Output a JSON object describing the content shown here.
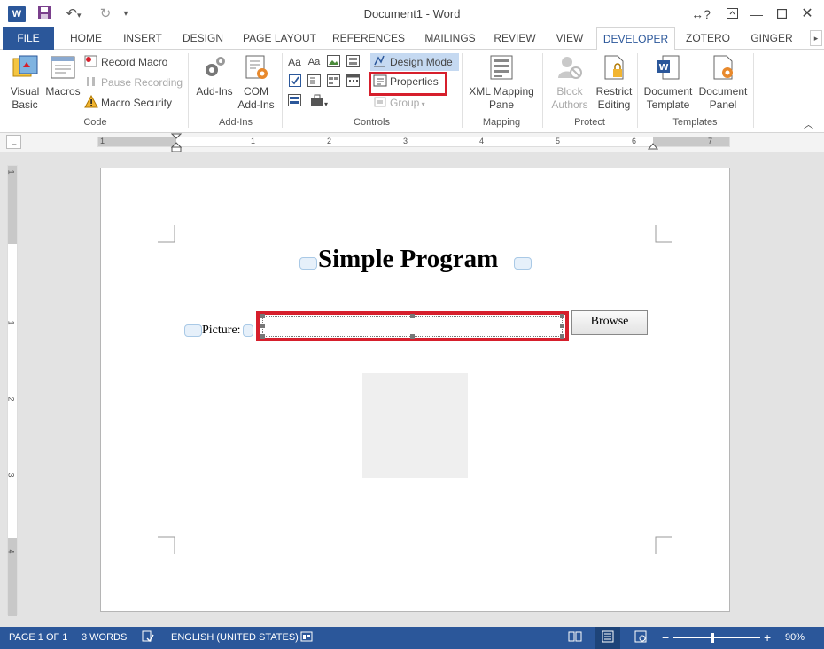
{
  "app": {
    "title": "Document1 - Word",
    "logo_letter": "W",
    "help_label": "?"
  },
  "tabs": [
    {
      "label": "FILE"
    },
    {
      "label": "HOME"
    },
    {
      "label": "INSERT"
    },
    {
      "label": "DESIGN"
    },
    {
      "label": "PAGE LAYOUT"
    },
    {
      "label": "REFERENCES"
    },
    {
      "label": "MAILINGS"
    },
    {
      "label": "REVIEW"
    },
    {
      "label": "VIEW"
    },
    {
      "label": "DEVELOPER"
    },
    {
      "label": "ZOTERO"
    },
    {
      "label": "GINGER"
    }
  ],
  "ribbon": {
    "code": {
      "label": "Code",
      "visual_basic": "Visual\nBasic",
      "macros": "Macros",
      "record_macro": "Record Macro",
      "pause_recording": "Pause Recording",
      "macro_security": "Macro Security"
    },
    "addins": {
      "label": "Add-Ins",
      "addins_btn": "Add-Ins",
      "com_addins": "COM\nAdd-Ins"
    },
    "controls": {
      "label": "Controls",
      "design_mode": "Design Mode",
      "properties": "Properties",
      "group": "Group"
    },
    "mapping": {
      "label": "Mapping",
      "xml_mapping_pane": "XML Mapping\nPane"
    },
    "protect": {
      "label": "Protect",
      "block_authors": "Block\nAuthors",
      "restrict_editing": "Restrict\nEditing"
    },
    "templates": {
      "label": "Templates",
      "document_template": "Document\nTemplate",
      "document_panel": "Document\nPanel"
    }
  },
  "ruler": {
    "numbers": [
      "1",
      "1",
      "2",
      "3",
      "4",
      "5",
      "6",
      "7"
    ],
    "vnumbers": [
      "1",
      "1",
      "2",
      "3",
      "4"
    ]
  },
  "document": {
    "heading": "Simple Program",
    "picture_label": "Picture:",
    "browse_label": "Browse"
  },
  "status": {
    "page": "PAGE 1 OF 1",
    "words": "3 WORDS",
    "language": "ENGLISH (UNITED STATES)",
    "zoom_minus": "−",
    "zoom_plus": "+",
    "zoom": "90%"
  },
  "colors": {
    "accent": "#2b579a",
    "highlight": "#d61f2c"
  }
}
